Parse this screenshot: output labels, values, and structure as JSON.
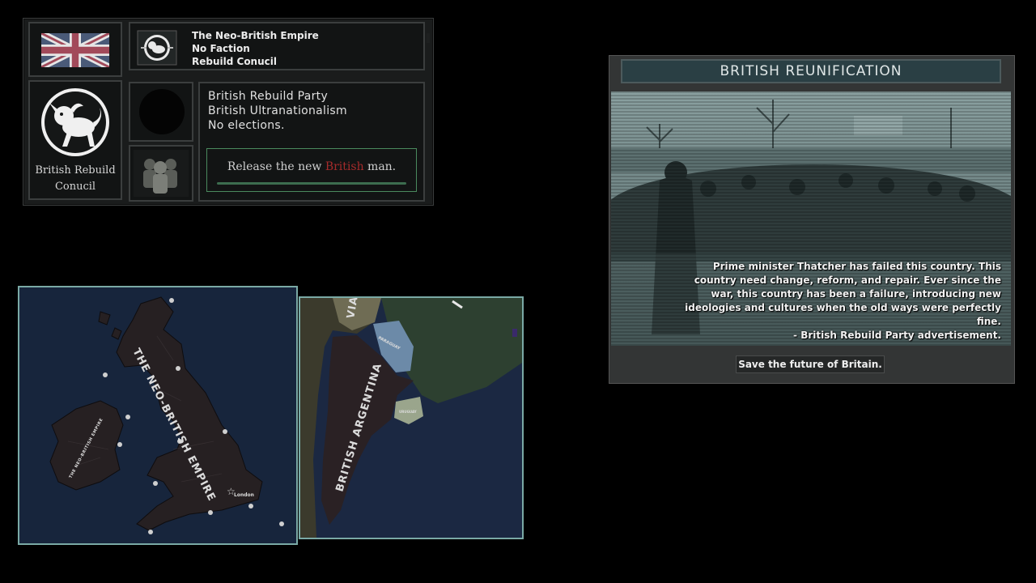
{
  "country_panel": {
    "country_name": "The Neo-British Empire",
    "faction": "No Faction",
    "government_label": "Rebuild Conucil",
    "emblem_caption_line1": "British Rebuild",
    "emblem_caption_line2": "Conucil",
    "party_name": "British Rebuild Party",
    "ideology": "British Ultranationalism",
    "elections": "No elections.",
    "slogan_before": "Release the new",
    "slogan_highlight": "British",
    "slogan_after": "man."
  },
  "event": {
    "title": "BRITISH REUNIFICATION",
    "description_lines": [
      "Prime minister Thatcher has failed this country. This",
      "country need change, reform, and repair. Ever since the",
      "war, this country has been a failure, introducing new",
      "ideologies and cultures when the old ways were perfectly fine.",
      "- British Rebuild Party advertisement."
    ],
    "option_label": "Save the future of Britain."
  },
  "map_britain": {
    "main_label": "THE NEO-BRITISH EMPIRE",
    "ireland_label": "THE NEO-BRITISH EMPIRE",
    "capital": "London"
  },
  "map_argentina": {
    "main_label": "BRITISH ARGENTINA",
    "neighbor_label": "PARAGUAY",
    "bolivia_fragment": "VIA",
    "uruguay_label": "URUGUAY"
  },
  "colors": {
    "accent_green": "#4a8a5e",
    "map_border": "#7aa9a5",
    "slogan_red": "#a52b2b"
  }
}
